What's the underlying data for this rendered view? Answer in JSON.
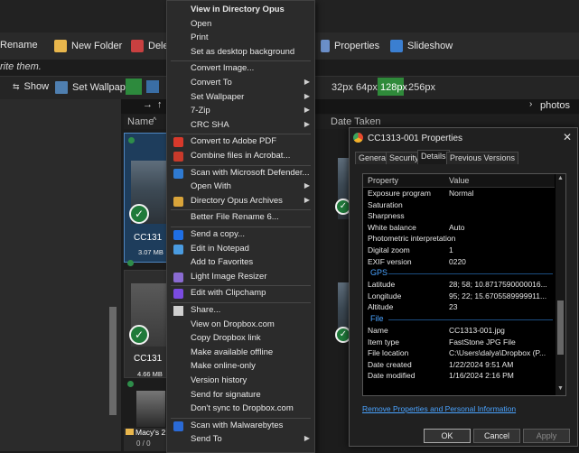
{
  "toolbar": {
    "rename": "Rename",
    "new_folder": "New Folder",
    "delete": "Delete",
    "properties": "Properties",
    "slideshow": "Slideshow",
    "hint": "rite them.",
    "show": "Show",
    "set_wallpaper": "Set Wallpaper",
    "sizes": [
      "32px",
      "64px",
      "128px",
      "256px"
    ],
    "active_size": "128px",
    "path_text": "photos"
  },
  "file_list": {
    "col_name": "Name",
    "col_date": "Date Taken",
    "items": [
      {
        "name": "CC131",
        "size": "3.07 MB"
      },
      {
        "name": "CC131",
        "size": "4.66 MB"
      }
    ],
    "folder_prefix": "Macy's 2",
    "page": "0 / 0"
  },
  "context_menu": {
    "items": [
      {
        "label": "View in Directory Opus",
        "bold": true
      },
      {
        "label": "Open"
      },
      {
        "label": "Print"
      },
      {
        "label": "Set as desktop background"
      },
      {
        "sep": true
      },
      {
        "label": "Convert Image..."
      },
      {
        "label": "Convert To",
        "sub": true
      },
      {
        "label": "Set Wallpaper",
        "sub": true
      },
      {
        "label": "7-Zip",
        "sub": true
      },
      {
        "label": "CRC SHA",
        "sub": true
      },
      {
        "sep": true
      },
      {
        "label": "Convert to Adobe PDF",
        "icon": "pdf-icon"
      },
      {
        "label": "Combine files in Acrobat...",
        "icon": "acrobat-icon"
      },
      {
        "sep": true
      },
      {
        "label": "Scan with Microsoft Defender...",
        "icon": "defender-shield-icon"
      },
      {
        "label": "Open With",
        "sub": true
      },
      {
        "label": "Directory Opus Archives",
        "icon": "archive-icon",
        "sub": true
      },
      {
        "sep": true
      },
      {
        "label": "Better File Rename 6..."
      },
      {
        "sep": true
      },
      {
        "label": "Send a copy...",
        "icon": "dropbox-icon"
      },
      {
        "label": "Edit in Notepad",
        "icon": "notepad-icon"
      },
      {
        "label": "Add to Favorites"
      },
      {
        "label": "Light Image Resizer",
        "icon": "resizer-icon"
      },
      {
        "sep": true
      },
      {
        "label": "Edit with Clipchamp",
        "icon": "clipchamp-icon"
      },
      {
        "sep": true
      },
      {
        "label": "Share...",
        "icon": "share-icon"
      },
      {
        "label": "View on Dropbox.com"
      },
      {
        "label": "Copy Dropbox link"
      },
      {
        "label": "Make available offline"
      },
      {
        "label": "Make online-only"
      },
      {
        "label": "Version history"
      },
      {
        "label": "Send for signature"
      },
      {
        "label": "Don't sync to Dropbox.com"
      },
      {
        "sep": true
      },
      {
        "label": "Scan with Malwarebytes",
        "icon": "malwarebytes-icon"
      },
      {
        "label": "Send To",
        "sub": true
      }
    ]
  },
  "properties_dialog": {
    "title": "CC1313-001 Properties",
    "tabs": [
      "General",
      "Security",
      "Details",
      "Previous Versions"
    ],
    "active_tab": "Details",
    "col_property": "Property",
    "col_value": "Value",
    "rows": [
      {
        "k": "Exposure program",
        "v": "Normal"
      },
      {
        "k": "Saturation",
        "v": ""
      },
      {
        "k": "Sharpness",
        "v": ""
      },
      {
        "k": "White balance",
        "v": "Auto"
      },
      {
        "k": "Photometric interpretation",
        "v": ""
      },
      {
        "k": "Digital zoom",
        "v": "1"
      },
      {
        "k": "EXIF version",
        "v": "0220"
      },
      {
        "group": "GPS"
      },
      {
        "k": "Latitude",
        "v": "28; 58; 10.8717590000016..."
      },
      {
        "k": "Longitude",
        "v": "95; 22; 15.6705589999911..."
      },
      {
        "k": "Altitude",
        "v": "23"
      },
      {
        "group": "File"
      },
      {
        "k": "Name",
        "v": "CC1313-001.jpg"
      },
      {
        "k": "Item type",
        "v": "FastStone JPG File"
      },
      {
        "k": "File location",
        "v": "C:\\Users\\dalya\\Dropbox (P..."
      },
      {
        "k": "Date created",
        "v": "1/22/2024 9:51 AM"
      },
      {
        "k": "Date modified",
        "v": "1/16/2024 2:16 PM"
      }
    ],
    "remove_link": "Remove Properties and Personal Information",
    "ok": "OK",
    "cancel": "Cancel",
    "apply": "Apply"
  }
}
